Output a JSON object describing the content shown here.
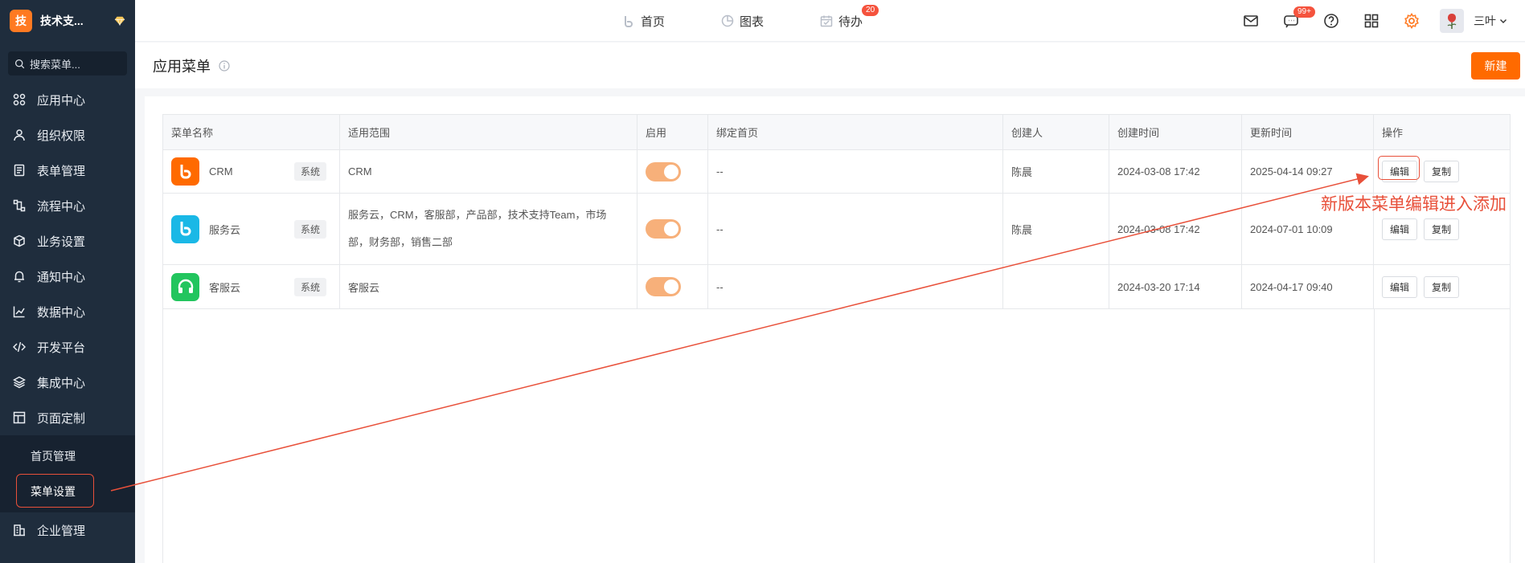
{
  "sidebar": {
    "logo_char": "技",
    "company": "技术支...",
    "search_placeholder": "搜索菜单...",
    "items": [
      {
        "label": "应用中心",
        "icon": "apps-icon"
      },
      {
        "label": "组织权限",
        "icon": "user-icon"
      },
      {
        "label": "表单管理",
        "icon": "form-icon"
      },
      {
        "label": "流程中心",
        "icon": "flow-icon"
      },
      {
        "label": "业务设置",
        "icon": "cube-icon"
      },
      {
        "label": "通知中心",
        "icon": "bell-icon"
      },
      {
        "label": "数据中心",
        "icon": "chart-icon"
      },
      {
        "label": "开发平台",
        "icon": "code-icon"
      },
      {
        "label": "集成中心",
        "icon": "layers-icon"
      },
      {
        "label": "页面定制",
        "icon": "layout-icon"
      }
    ],
    "subitems": [
      {
        "label": "首页管理"
      },
      {
        "label": "菜单设置"
      }
    ],
    "bottom_item": {
      "label": "企业管理",
      "icon": "building-icon"
    }
  },
  "topnav": {
    "items": [
      {
        "label": "首页"
      },
      {
        "label": "图表"
      },
      {
        "label": "待办",
        "badge": "20"
      }
    ]
  },
  "topright": {
    "chat_badge": "99+",
    "username": "三叶"
  },
  "page": {
    "title": "应用菜单",
    "new_button": "新建"
  },
  "table": {
    "headers": [
      "菜单名称",
      "适用范围",
      "启用",
      "绑定首页",
      "创建人",
      "创建时间",
      "更新时间",
      "操作"
    ],
    "rows": [
      {
        "name": "CRM",
        "tag": "系统",
        "scope": "CRM",
        "enabled": true,
        "home": "--",
        "creator": "陈晨",
        "created": "2024-03-08 17:42",
        "updated": "2025-04-14 09:27",
        "icon_color": "#ff6a00"
      },
      {
        "name": "服务云",
        "tag": "系统",
        "scope": "服务云，CRM，客服部，产品部，技术支持Team，市场部，财务部，销售二部",
        "enabled": true,
        "home": "--",
        "creator": "陈晨",
        "created": "2024-03-08 17:42",
        "updated": "2024-07-01 10:09",
        "icon_color": "#1ab8e6"
      },
      {
        "name": "客服云",
        "tag": "系统",
        "scope": "客服云",
        "enabled": true,
        "home": "--",
        "creator": "",
        "created": "2024-03-20 17:14",
        "updated": "2024-04-17 09:40",
        "icon_color": "#22c55e"
      }
    ],
    "edit_label": "编辑",
    "copy_label": "复制"
  },
  "annotation": {
    "text": "新版本菜单编辑进入添加",
    "color": "#e8503a"
  },
  "colors": {
    "sidebar_bg": "#1f2d3d",
    "accent": "#ff6a00"
  }
}
